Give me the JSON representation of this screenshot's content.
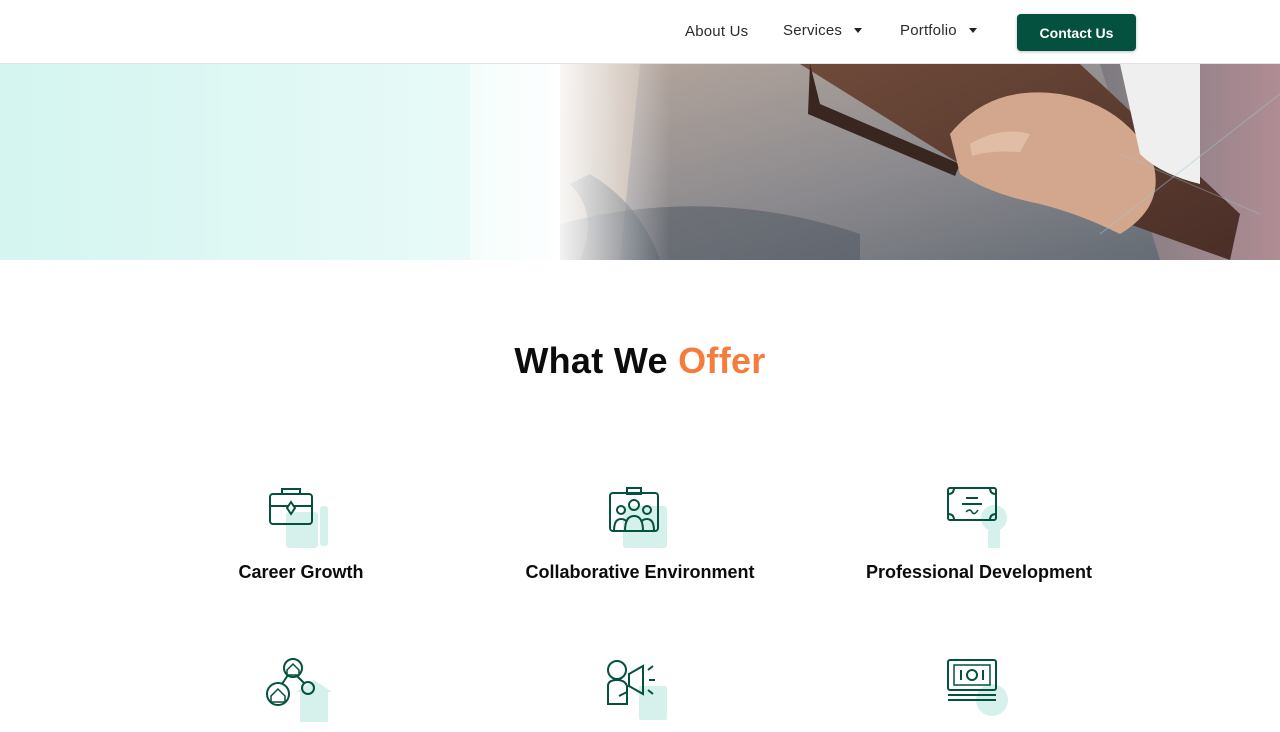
{
  "nav": {
    "about": "About Us",
    "services": "Services",
    "portfolio": "Portfolio",
    "contact": "Contact Us"
  },
  "hero": {
    "image": "businessman-holding-folder-photo"
  },
  "section": {
    "title_main": "What We",
    "title_accent": "Offer"
  },
  "offers": [
    {
      "label": "Career Growth",
      "icon": "briefcase-icon"
    },
    {
      "label": "Collaborative Environment",
      "icon": "team-icon"
    },
    {
      "label": "Professional Development",
      "icon": "certificate-icon"
    },
    {
      "label": "",
      "icon": "network-home-icon"
    },
    {
      "label": "",
      "icon": "speaker-megaphone-icon"
    },
    {
      "label": "",
      "icon": "money-stack-icon"
    }
  ],
  "colors": {
    "primary": "#03513e",
    "accent": "#f47c3c",
    "icon_tint": "#d6f1ec"
  }
}
